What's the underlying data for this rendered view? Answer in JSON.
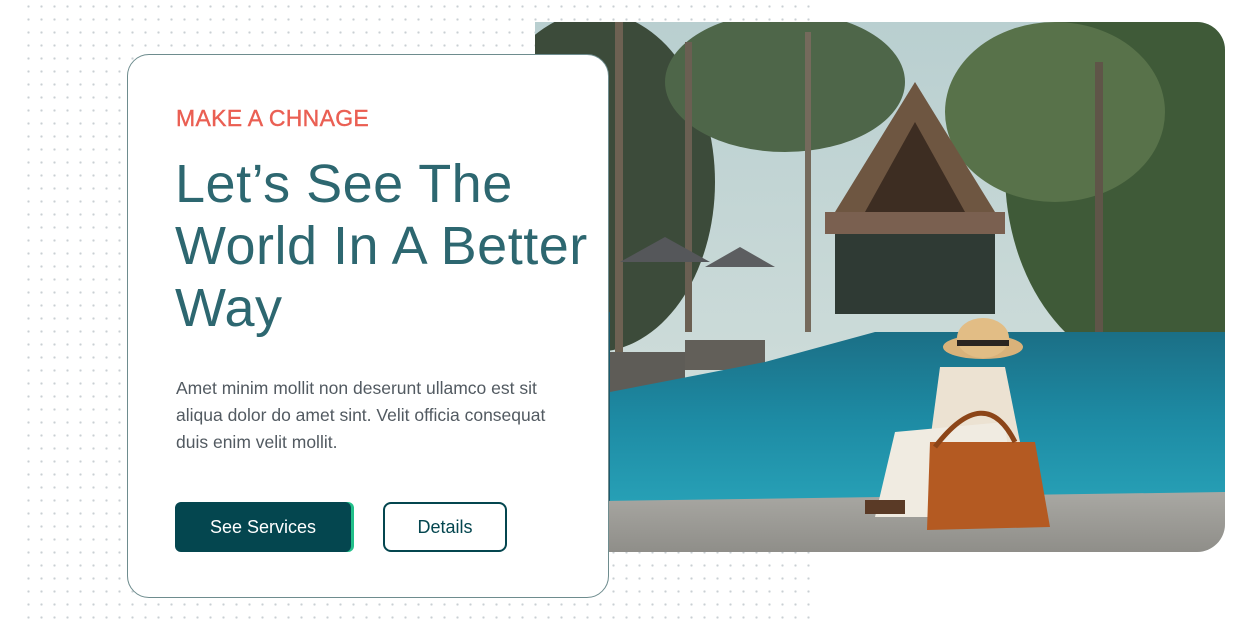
{
  "hero": {
    "eyebrow": "MAKE A CHNAGE",
    "title": "Let’s See The World In A Better Way",
    "description": "Amet minim mollit non deserunt ullamco est sit aliqua dolor do amet sint. Velit officia consequat duis enim velit mollit.",
    "primary_button": "See Services",
    "secondary_button": "Details"
  },
  "colors": {
    "accent": "#ea5f53",
    "heading": "#2d6770",
    "primary": "#04464f",
    "primary_edge": "#22c08a"
  }
}
